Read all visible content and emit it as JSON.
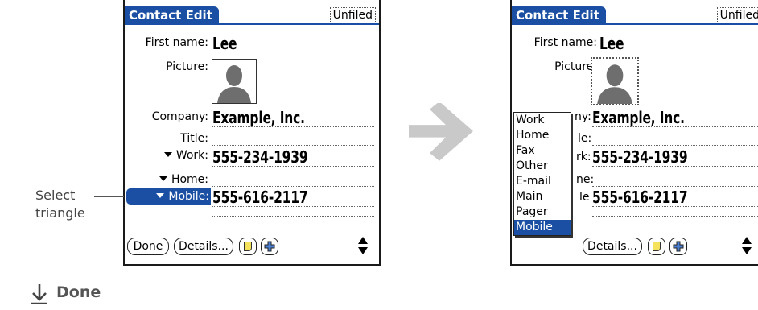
{
  "left_screen": {
    "title": "Contact Edit",
    "category": "Unfiled",
    "fields": {
      "first_name_label": "First name:",
      "first_name_value": "Lee",
      "picture_label": "Picture:",
      "company_label": "Company:",
      "company_value": "Example, Inc.",
      "title_label": "Title:",
      "work_label": "Work:",
      "work_value": "555-234-1939",
      "home_label": "Home:",
      "mobile_label": "Mobile:",
      "mobile_value": "555-616-2117"
    },
    "buttons": {
      "done": "Done",
      "details": "Details..."
    }
  },
  "right_screen": {
    "title": "Contact Edit",
    "category": "Unfiled",
    "fields": {
      "first_name_label": "First name:",
      "first_name_value": "Lee",
      "picture_label": "Picture:",
      "company_label_partial": "ny:",
      "company_value": "Example, Inc.",
      "title_label_partial": "le:",
      "work_label_partial": "rk:",
      "work_value": "555-234-1939",
      "home_label_partial": "ne:",
      "mobile_label_partial": "le",
      "mobile_value": "555-616-2117"
    },
    "popup_options": [
      "Work",
      "Home",
      "Fax",
      "Other",
      "E-mail",
      "Main",
      "Pager",
      "Mobile"
    ],
    "popup_selected": "Mobile",
    "buttons": {
      "details": "Details..."
    }
  },
  "callout": {
    "line1": "Select",
    "line2": "triangle"
  },
  "footer": {
    "label": "Done"
  },
  "colors": {
    "accent": "#1a4fa3",
    "arrow": "#c9c9c9",
    "note": "#f3e25a"
  },
  "icons": [
    "person-silhouette-icon",
    "note-icon",
    "plus-icon",
    "scroll-arrows-icon",
    "right-arrow-icon",
    "down-arrow-icon"
  ]
}
